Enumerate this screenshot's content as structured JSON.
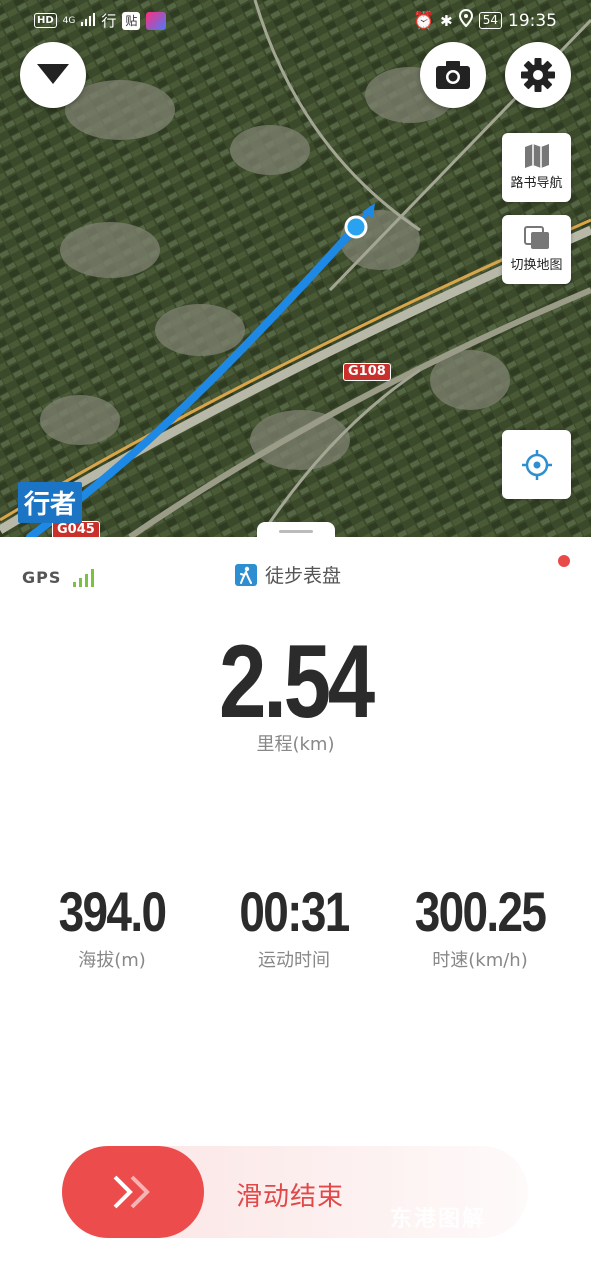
{
  "status_bar": {
    "hd": "HD",
    "network": "4G",
    "app_glyph_1": "行",
    "app_glyph_2": "贴",
    "battery": "54",
    "time": "19:35",
    "icons": [
      "alarm-icon",
      "bluetooth-icon",
      "location-icon"
    ]
  },
  "map": {
    "buttons": {
      "collapse": "chevron-down-icon",
      "camera": "camera-icon",
      "settings": "gear-icon"
    },
    "side_buttons": {
      "roadbook_label": "路书导航",
      "switch_map_label": "切换地图",
      "locate": "locate-icon"
    },
    "road_labels": {
      "g108": "G108",
      "g045": "G045"
    },
    "brand": "行者",
    "colors": {
      "track": "#1e88e5",
      "road_label": "#c9302c"
    }
  },
  "panel": {
    "gps_label": "GPS",
    "gps_signal_bars": 4,
    "mode_label": "徒步表盘",
    "distance": {
      "value": "2.54",
      "label": "里程(km)"
    },
    "stats": [
      {
        "key": "altitude",
        "value": "394.0",
        "label": "海拔(m)"
      },
      {
        "key": "time",
        "value": "00:31",
        "label": "运动时间"
      },
      {
        "key": "speed",
        "value": "300.25",
        "label": "时速(km/h)"
      }
    ],
    "slide_to_end": "滑动结束",
    "watermark": "东港图解",
    "colors": {
      "accent": "#ec4c4c",
      "gps_green": "#7cc242"
    }
  }
}
